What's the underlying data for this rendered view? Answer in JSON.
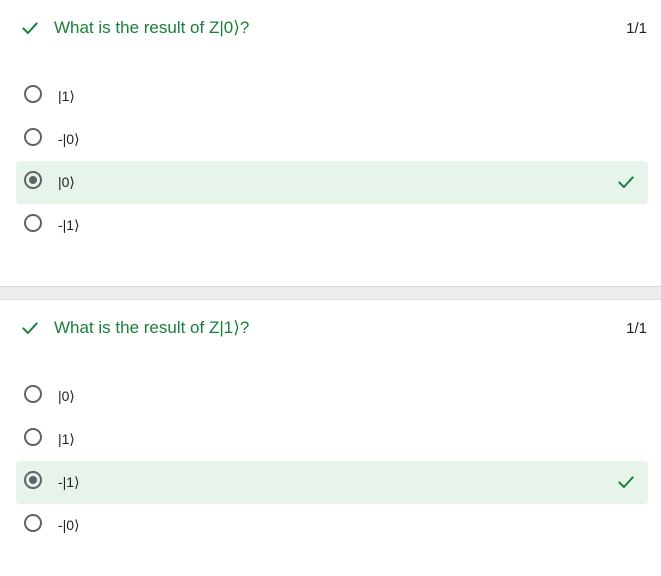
{
  "accent_color": "#188038",
  "correct_bg": "#e6f4ea",
  "questions": [
    {
      "title": "What is the result of Z|0⟩?",
      "score": "1/1",
      "status_icon": "check-icon",
      "options": [
        {
          "label": "|1⟩",
          "selected": false,
          "correct": false
        },
        {
          "label": "-|0⟩",
          "selected": false,
          "correct": false
        },
        {
          "label": "|0⟩",
          "selected": true,
          "correct": true
        },
        {
          "label": "-|1⟩",
          "selected": false,
          "correct": false
        }
      ]
    },
    {
      "title": "What is the result of Z|1⟩?",
      "score": "1/1",
      "status_icon": "check-icon",
      "options": [
        {
          "label": "|0⟩",
          "selected": false,
          "correct": false
        },
        {
          "label": "|1⟩",
          "selected": false,
          "correct": false
        },
        {
          "label": "-|1⟩",
          "selected": true,
          "correct": true
        },
        {
          "label": "-|0⟩",
          "selected": false,
          "correct": false
        }
      ]
    }
  ]
}
